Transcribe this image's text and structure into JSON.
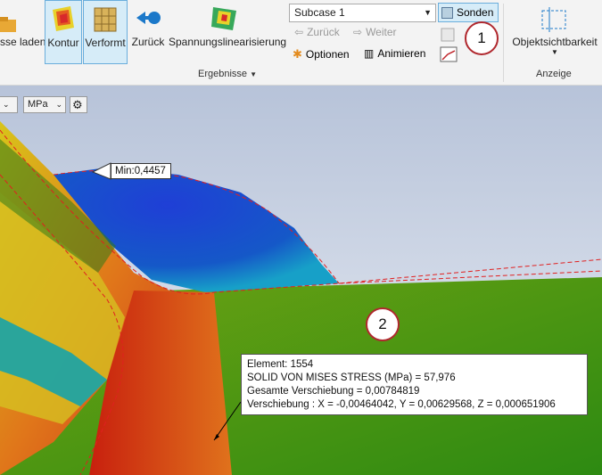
{
  "ribbon": {
    "ergebnisse_laden_label": "sse laden",
    "kontur_label": "Kontur",
    "verformt_label": "Verformt",
    "zurueck_label": "Zurück",
    "spannungslinearisierung_label": "Spannungslinearisierung",
    "subcase_value": "Subcase 1",
    "sonden_label": "Sonden",
    "nav_back_label": "Zurück",
    "nav_forward_label": "Weiter",
    "optionen_label": "Optionen",
    "animieren_label": "Animieren",
    "ergebnisse_group": "Ergebnisse",
    "objektsichtbarkeit_label": "Objektsichtbarkeit",
    "anzeige_group": "Anzeige"
  },
  "viewport": {
    "unit_value": "MPa",
    "min_label": "Min:0,4457",
    "probe": {
      "element": "Element: 1554",
      "stress": "SOLID VON MISES STRESS (MPa)   = 57,976",
      "displacement_total": "Gesamte Verschiebung = 0,00784819",
      "displacement_xyz": "Verschiebung : X = -0,00464042, Y = 0,00629568, Z = 0,000651906"
    }
  },
  "callouts": [
    "1",
    "2"
  ],
  "colors": {
    "accent_blue": "#1b78c9",
    "callout_red": "#b0282e",
    "active_fill": "#d6ecf8"
  },
  "icons": [
    "folder-icon",
    "contour-icon",
    "deformed-icon",
    "back-arrow-icon",
    "linearization-icon",
    "probe-icon",
    "options-icon",
    "animate-icon",
    "visibility-icon",
    "gear-icon"
  ]
}
